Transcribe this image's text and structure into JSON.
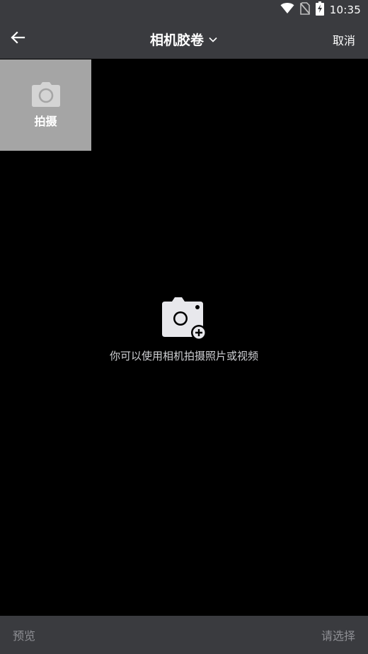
{
  "status_bar": {
    "time": "10:35",
    "icons": [
      "wifi-icon",
      "no-sim-icon",
      "battery-charging-icon"
    ]
  },
  "app_bar": {
    "back_icon": "arrow-left-icon",
    "title": "相机胶卷",
    "title_dropdown_icon": "chevron-down-icon",
    "cancel_label": "取消"
  },
  "grid": {
    "capture_tile": {
      "icon": "camera-icon",
      "label": "拍摄"
    }
  },
  "empty_state": {
    "icon": "camera-add-icon",
    "message": "你可以使用相机拍摄照片或视频"
  },
  "bottom_bar": {
    "preview_label": "预览",
    "select_label": "请选择"
  },
  "colors": {
    "bar_background": "#3a3b3f",
    "content_background": "#000000",
    "tile_background": "#a5a5a5",
    "disabled_text": "#8e8f94"
  }
}
